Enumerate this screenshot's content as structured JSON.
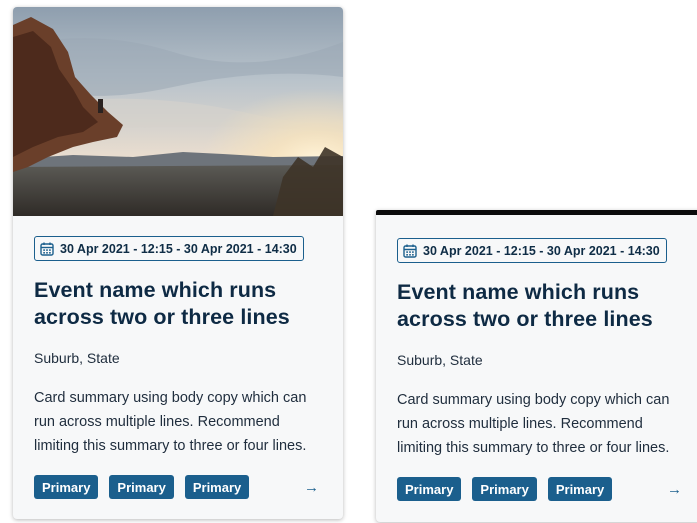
{
  "cards": [
    {
      "date": "30 Apr 2021 - 12:15 - 30 Apr 2021 - 14:30",
      "title": "Event name which runs across two or three lines",
      "location": "Suburb, State",
      "summary": "Card summary using body copy which can run across multiple lines. Recommend limiting this summary to three or four lines.",
      "tags": [
        "Primary",
        "Primary",
        "Primary"
      ],
      "has_image": true,
      "image_icon": "landscape-photo",
      "date_icon": "calendar-icon",
      "link_icon": "arrow-right-icon"
    },
    {
      "date": "30 Apr 2021 - 12:15 - 30 Apr 2021 - 14:30",
      "title": "Event name which runs across two or three lines",
      "location": "Suburb, State",
      "summary": "Card summary using body copy which can run across multiple lines. Recommend limiting this summary to three or four lines.",
      "tags": [
        "Primary",
        "Primary",
        "Primary"
      ],
      "has_image": false,
      "date_icon": "calendar-icon",
      "link_icon": "arrow-right-icon"
    }
  ],
  "colors": {
    "accent": "#1b5f8d",
    "heading": "#0e2a44",
    "text": "#1f2d3d",
    "card_background": "#f7f8f9",
    "top_border": "#0c0c0c"
  }
}
